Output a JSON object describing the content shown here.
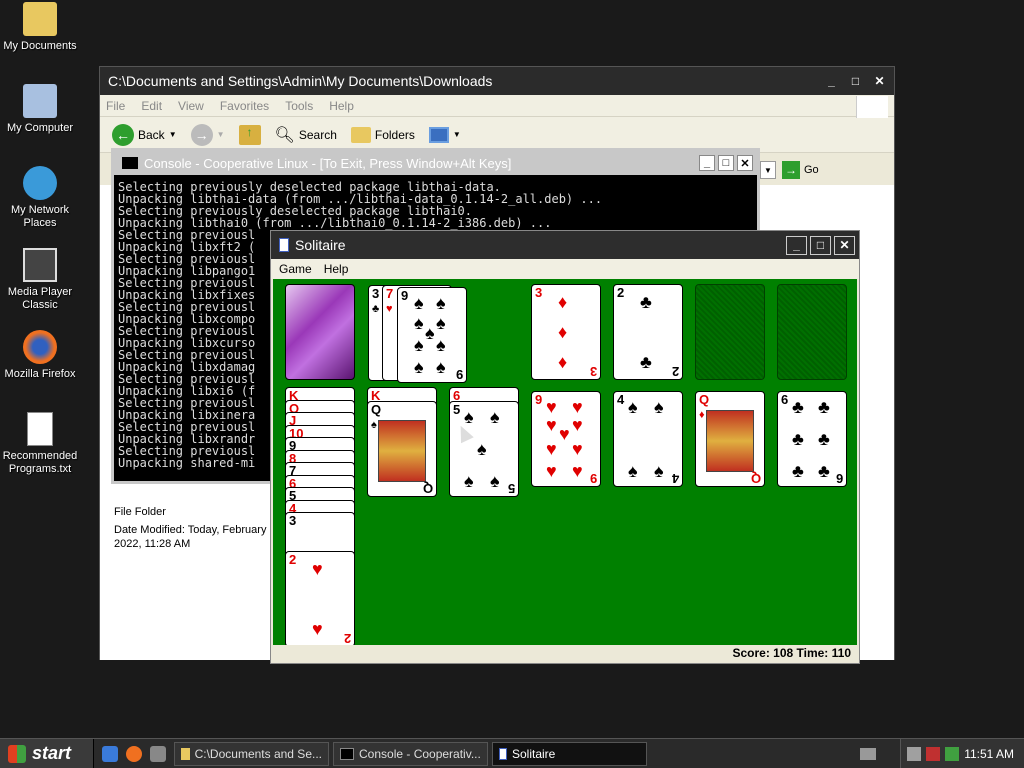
{
  "desktop": {
    "icons": [
      {
        "label": "My Documents"
      },
      {
        "label": "My Computer"
      },
      {
        "label": "My Network Places"
      },
      {
        "label": "Media Player Classic"
      },
      {
        "label": "Mozilla Firefox"
      },
      {
        "label": "Recommended Programs.txt"
      }
    ]
  },
  "explorer": {
    "title": "C:\\Documents and Settings\\Admin\\My Documents\\Downloads",
    "menu": [
      "File",
      "Edit",
      "View",
      "Favorites",
      "Tools",
      "Help"
    ],
    "toolbar": {
      "back": "Back",
      "search": "Search",
      "folders": "Folders",
      "go": "Go"
    },
    "details": {
      "type": "File Folder",
      "modified": "Date Modified: Today, February 18, 2022, 11:28 AM"
    }
  },
  "console": {
    "title": "Console - Cooperative Linux - [To Exit, Press Window+Alt Keys]",
    "lines": [
      "Selecting previously deselected package libthai-data.",
      "Unpacking libthai-data (from .../libthai-data_0.1.14-2_all.deb) ...",
      "Selecting previously deselected package libthai0.",
      "Unpacking libthai0 (from .../libthai0_0.1.14-2_i386.deb) ...",
      "Selecting previousl",
      "Unpacking libxft2 (",
      "Selecting previousl",
      "Unpacking libpango1",
      "Selecting previousl",
      "Unpacking libxfixes",
      "Selecting previousl",
      "Unpacking libxcompo",
      "Selecting previousl",
      "Unpacking libxcurso",
      "Selecting previousl",
      "Unpacking libxdamag",
      "Selecting previousl",
      "Unpacking libxi6 (f",
      "Selecting previousl",
      "Unpacking libxinera",
      "Selecting previousl",
      "Unpacking libxrandr",
      "Selecting previousl",
      "Unpacking shared-mi"
    ]
  },
  "solitaire": {
    "title": "Solitaire",
    "menu": [
      "Game",
      "Help"
    ],
    "status": "Score: 108 Time: 110",
    "score": 108,
    "time": 110
  },
  "taskbar": {
    "start": "start",
    "tasks": [
      {
        "label": "C:\\Documents and Se..."
      },
      {
        "label": "Console - Cooperativ..."
      },
      {
        "label": "Solitaire"
      }
    ],
    "clock": "11:51 AM"
  },
  "colors": {
    "felt": "#008000",
    "red_suit": "#e00000"
  }
}
